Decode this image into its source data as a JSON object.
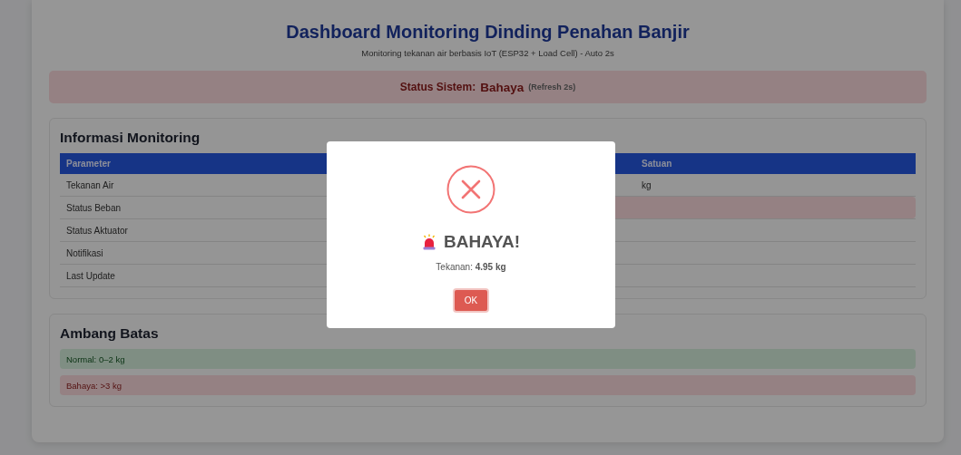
{
  "header": {
    "title": "Dashboard Monitoring Dinding Penahan Banjir",
    "subtitle": "Monitoring tekanan air berbasis IoT (ESP32 + Load Cell) - Auto 2s"
  },
  "status_bar": {
    "label": "Status Sistem:",
    "value": "Bahaya",
    "note": "(Refresh 2s)",
    "kind": "danger"
  },
  "monitoring": {
    "title": "Informasi Monitoring",
    "columns": [
      "Parameter",
      "Satuan"
    ],
    "rows": [
      {
        "parameter": "Tekanan Air",
        "unit": "kg",
        "alert": false
      },
      {
        "parameter": "Status Beban",
        "alert": true
      },
      {
        "parameter": "Status Aktuator",
        "alert": false
      },
      {
        "parameter": "Notifikasi",
        "alert": false
      },
      {
        "parameter": "Last Update",
        "alert": false
      }
    ]
  },
  "thresholds": {
    "title": "Ambang Batas",
    "items": [
      {
        "text": "Normal: 0–2 kg",
        "kind": "success"
      },
      {
        "text": "Bahaya: >3 kg",
        "kind": "danger"
      }
    ]
  },
  "dialog": {
    "kind": "error",
    "title": "BAHAYA!",
    "message": "Tekanan: **4.95 kg**",
    "button": "OK"
  }
}
